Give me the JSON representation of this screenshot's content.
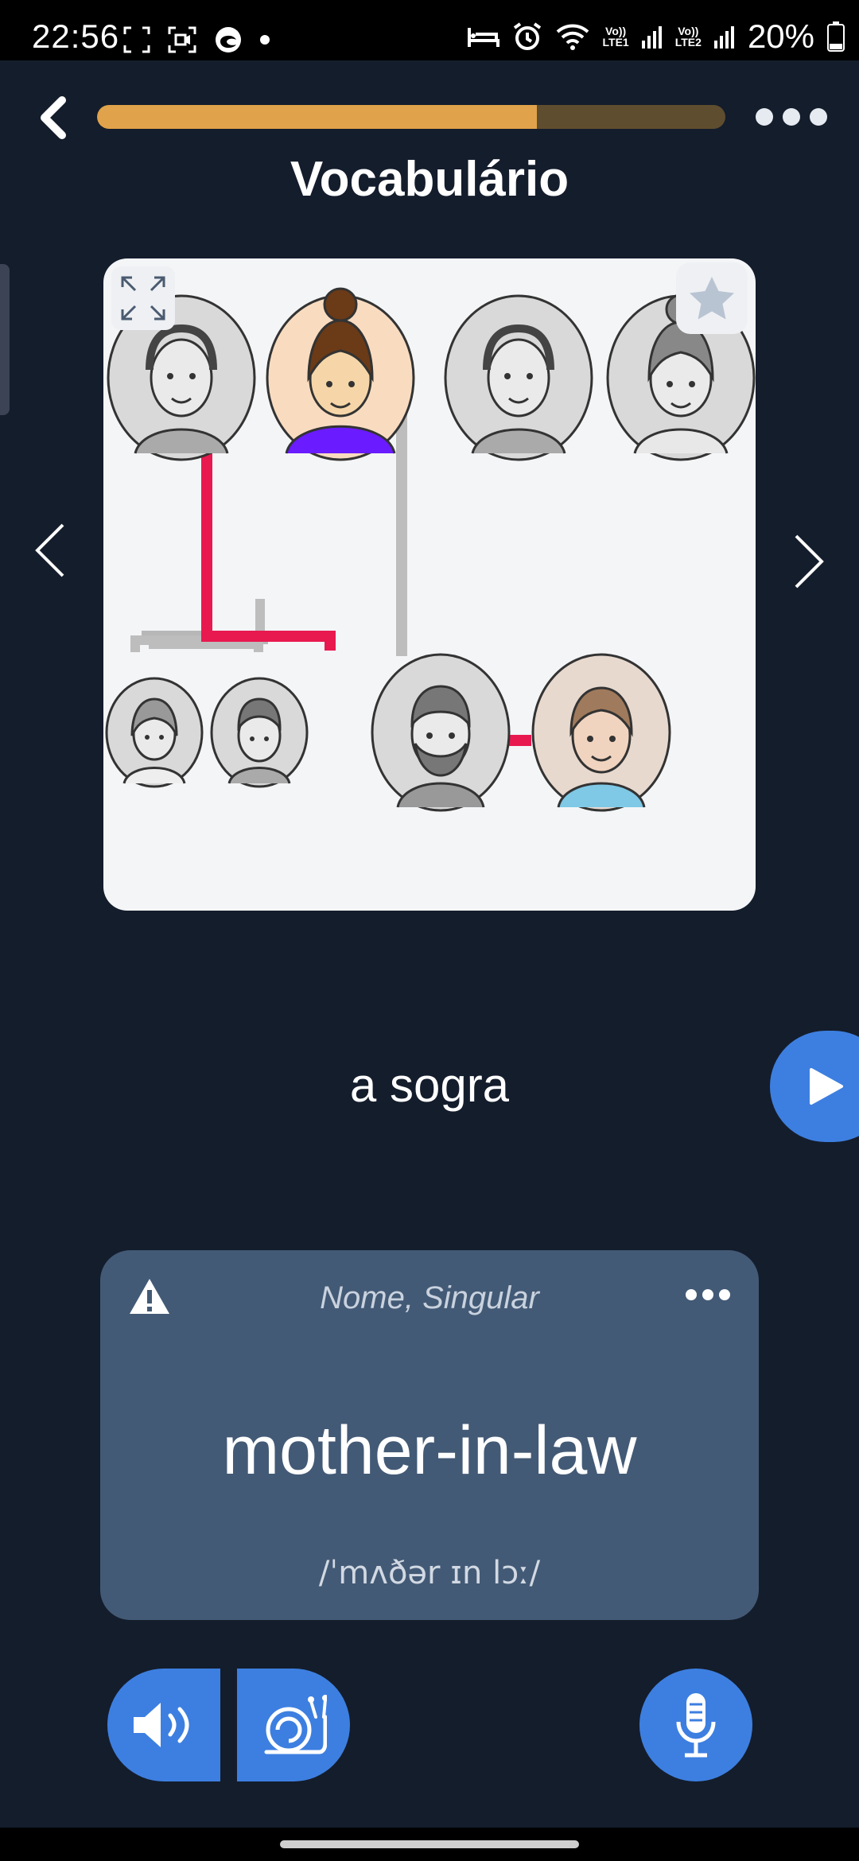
{
  "status_bar": {
    "time": "22:56",
    "battery": "20%",
    "sim1": "LTE1",
    "sim2": "LTE2",
    "volte": "Vo))"
  },
  "header": {
    "title": "Vocabulário",
    "progress": 0.7
  },
  "card": {
    "word": "a sogra",
    "part_of_speech": "Nome, Singular",
    "translation": "mother-in-law",
    "phonetic": "/ˈmʌðər ɪn lɔː/"
  },
  "colors": {
    "background": "#141d2c",
    "accent_blue": "#3d7fe0",
    "progress_fill": "#e0a24a",
    "progress_track": "#5f4d2f",
    "card_panel": "#435a76",
    "highlight_line": "#e8194f",
    "highlight_person": "#6a1bff"
  },
  "icons": [
    "back-icon",
    "more-icon",
    "expand-icon",
    "star-icon",
    "chevron-left-icon",
    "chevron-right-icon",
    "play-icon",
    "warning-icon",
    "speaker-icon",
    "snail-icon",
    "microphone-icon"
  ]
}
